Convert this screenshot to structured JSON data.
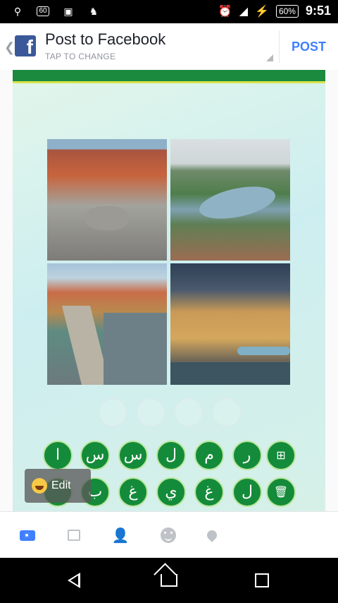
{
  "status_bar": {
    "usb_icon": "usb-icon",
    "box_label": "60",
    "image_icon": "image-icon",
    "android_icon": "android-icon",
    "alarm_icon": "alarm-icon",
    "signal_icon": "signal-icon",
    "battery": "60%",
    "time": "9:51"
  },
  "app_bar": {
    "title": "Post to Facebook",
    "subtitle": "TAP TO CHANGE",
    "post_label": "POST",
    "back_icon": "back-chevron-icon",
    "logo_icon": "facebook-logo-icon",
    "accent": "#4080ff",
    "brand": "#3b5998"
  },
  "game": {
    "header_color": "#1b8a3e",
    "answer_slots": 4,
    "photos": [
      "prague-old-town-square",
      "prague-river-aerial",
      "charles-bridge",
      "vltava-riverside-buildings"
    ],
    "letter_row_1": [
      "ا",
      "س",
      "س",
      "ل",
      "م",
      "ر"
    ],
    "letter_row_2": [
      "ب",
      "غ",
      "ي",
      "غ",
      "ل"
    ],
    "hint_icon": "hint-sign-icon",
    "delete_icon": "trash-icon",
    "key_color": "#148b3a",
    "edit_chip": {
      "icon": "smiley-icon",
      "label": "Edit"
    }
  },
  "composer_toolbar": {
    "items": [
      "camera-icon",
      "photo-icon",
      "tag-people-icon",
      "emoji-icon",
      "location-icon"
    ]
  },
  "nav_bar": {
    "back": "nav-back-icon",
    "home": "nav-home-icon",
    "recents": "nav-recents-icon"
  }
}
